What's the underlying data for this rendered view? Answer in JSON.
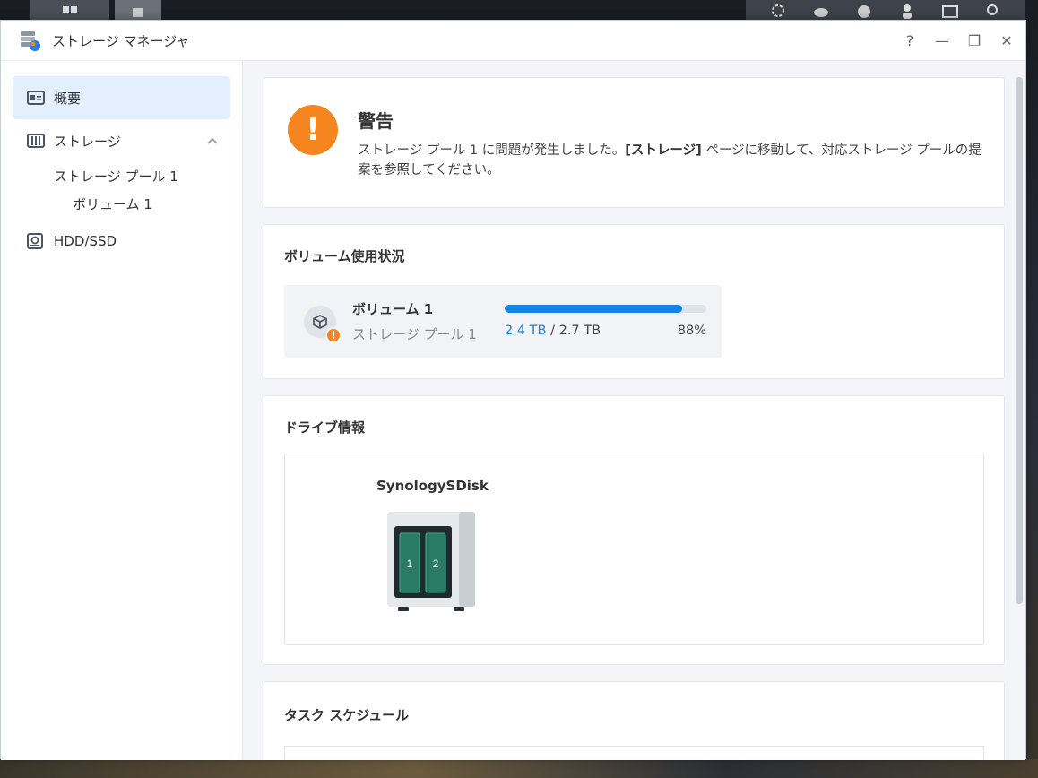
{
  "window": {
    "title": "ストレージ マネージャ",
    "controls": {
      "help": "?",
      "minimize": "—",
      "restore": "❐",
      "close": "✕"
    }
  },
  "sidebar": {
    "items": [
      {
        "label": "概要",
        "icon": "overview-icon",
        "active": true
      },
      {
        "label": "ストレージ",
        "icon": "storage-icon",
        "expanded": true
      },
      {
        "label": "HDD/SSD",
        "icon": "hdd-icon"
      }
    ],
    "storage_pool": "ストレージ プール 1",
    "volume": "ボリューム 1"
  },
  "warning": {
    "title": "警告",
    "text_before": "ストレージ プール 1 に問題が発生しました。",
    "text_bold": "[ストレージ]",
    "text_after": " ページに移動して、対応ストレージ プールの提案を参照してください。",
    "color": "#f5861f"
  },
  "volume_usage": {
    "section_title": "ボリューム使用状況",
    "volume_name": "ボリューム 1",
    "pool_name": "ストレージ プール 1",
    "used": "2.4 TB",
    "separator": " / ",
    "total": "2.7 TB",
    "percent": "88%",
    "fill_fraction": 0.88
  },
  "drive_info": {
    "section_title": "ドライブ情報",
    "device_name": "SynologySDisk",
    "bays": [
      "1",
      "2"
    ]
  },
  "task_schedule": {
    "section_title": "タスク スケジュール"
  },
  "colors": {
    "accent": "#1582e6",
    "warning": "#f5861f",
    "active_nav": "#e4effd"
  }
}
